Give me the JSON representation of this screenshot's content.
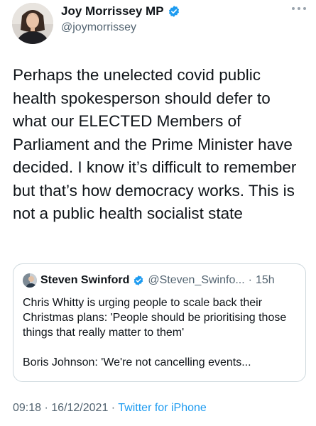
{
  "author": {
    "name": "Joy Morrissey MP",
    "handle": "@joymorrissey",
    "verified": true
  },
  "tweet": {
    "text": "Perhaps the unelected covid public health spokesperson should defer to what our ELECTED Members of Parliament and the Prime Minister have decided. I know it’s difficult to remember but that’s how democracy works. This is not a public health socialist state"
  },
  "quoted": {
    "name": "Steven Swinford",
    "handle": "@Steven_Swinfo...",
    "separator": "·",
    "time": "15h",
    "verified": true,
    "paragraphs": [
      "Chris Whitty is urging people to scale back their Christmas plans: 'People should be prioritising those things that really matter to them'",
      "Boris Johnson: 'We're not cancelling events..."
    ]
  },
  "meta": {
    "time": "09:18",
    "dot1": " · ",
    "date": "16/12/2021",
    "dot2": " · ",
    "source": "Twitter for iPhone"
  },
  "colors": {
    "text": "#0f1419",
    "secondary": "#536471",
    "accent": "#1d9bf0",
    "border": "#cfd9de"
  },
  "icons": [
    "avatar-photo",
    "verified-badge-icon",
    "more-options-icon"
  ]
}
